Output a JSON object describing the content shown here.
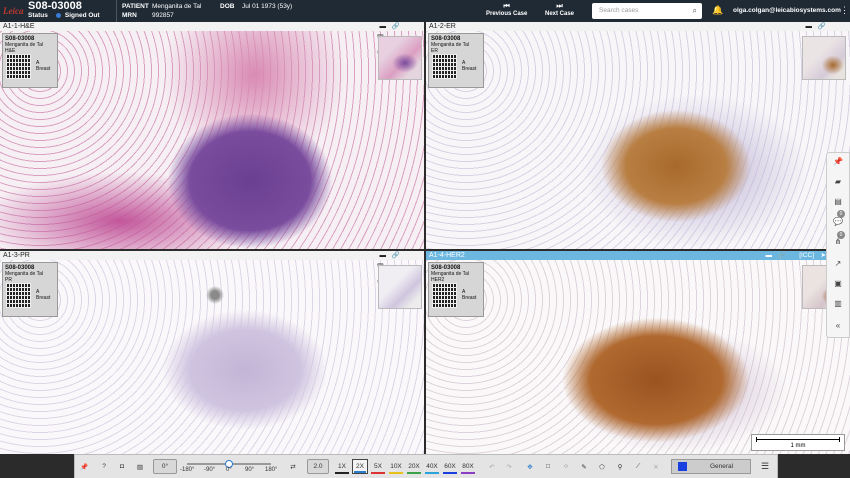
{
  "header": {
    "logo_text": "Leica",
    "case_id": "S08-03008",
    "status_label": "Status",
    "status_value": "Signed Out",
    "patient_label": "PATIENT",
    "patient_name": "Menganita de Tal",
    "dob_label": "DOB",
    "dob_value": "Jul 01 1973 (53y)",
    "mrn_label": "MRN",
    "mrn_value": "992857",
    "prev_case": "Previous Case",
    "next_case": "Next Case",
    "search_placeholder": "Search cases",
    "user_email": "olga.colgan@leicabiosystems.com"
  },
  "panes": [
    {
      "name": "A1-1-H&E",
      "label_case": "S08-03008",
      "label_sub": "Menganita de Tal",
      "label_stain": "H&E",
      "label_a": "A",
      "label_site": "Breast",
      "active": false
    },
    {
      "name": "A1-2-ER",
      "label_case": "S08-03008",
      "label_sub": "Menganita de Tal",
      "label_stain": "ER",
      "label_a": "A",
      "label_site": "Breast",
      "active": false
    },
    {
      "name": "A1-3-PR",
      "label_case": "S08-03008",
      "label_sub": "Menganita de Tal",
      "label_stain": "PR",
      "label_a": "A",
      "label_site": "Breast",
      "active": false
    },
    {
      "name": "A1-4-HER2",
      "label_case": "S08-03008",
      "label_sub": "Menganita de Tal",
      "label_stain": "HER2",
      "label_a": "A",
      "label_site": "Breast",
      "active": true,
      "tag": "[ICC]"
    }
  ],
  "scale": {
    "text": "1 mm"
  },
  "toolbar": {
    "rotation_value": "0°",
    "rotation_ticks": [
      "-180°",
      "-90°",
      "0°",
      "90°",
      "180°"
    ],
    "rotation_fraction": 0.5,
    "magnification": "2.0",
    "zoom_levels": [
      "1X",
      "2X",
      "5X",
      "10X",
      "20X",
      "40X",
      "60X",
      "80X"
    ],
    "zoom_selected": "2X",
    "annotation_class": "General",
    "annotation_color": "#1a3fe0"
  },
  "colors": {
    "header_bg": "#1f2a35",
    "active_pane": "#6bb7e0",
    "accent": "#2b7bd1"
  }
}
